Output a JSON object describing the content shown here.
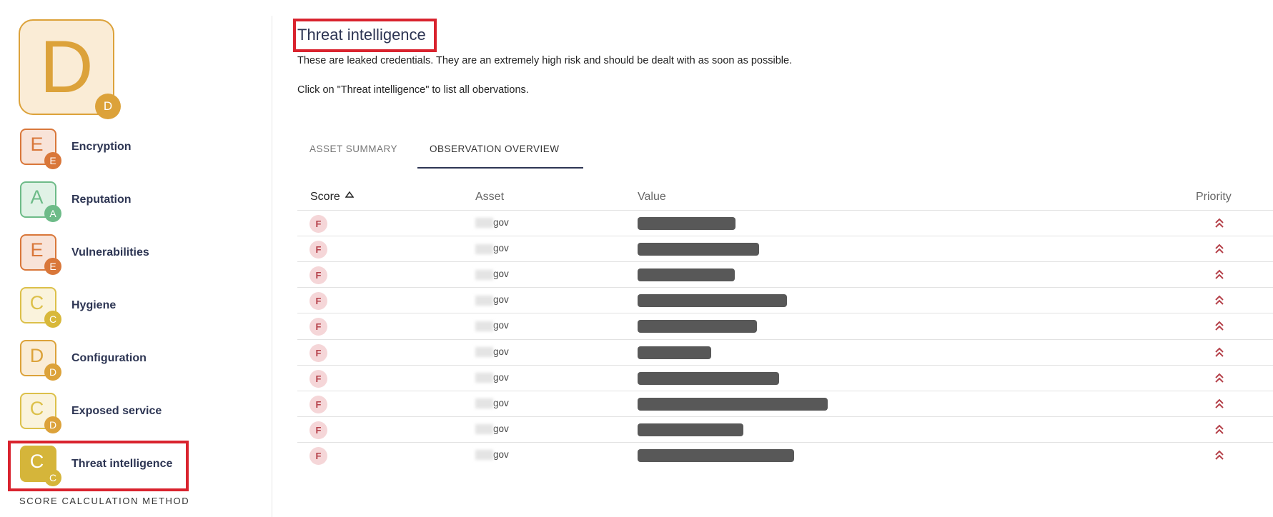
{
  "overall": {
    "grade": "D",
    "badge": "D",
    "color": "#dca23a"
  },
  "sidebar": {
    "items": [
      {
        "label": "Encryption",
        "grade": "E",
        "badge": "E",
        "color": "#d9773a",
        "bg": "#f8e3d8"
      },
      {
        "label": "Reputation",
        "grade": "A",
        "badge": "A",
        "color": "#6dbb88",
        "bg": "#e0f2e6"
      },
      {
        "label": "Vulnerabilities",
        "grade": "E",
        "badge": "E",
        "color": "#d9773a",
        "bg": "#f8e3d8"
      },
      {
        "label": "Hygiene",
        "grade": "C",
        "badge": "C",
        "color": "#dcc04a",
        "bg": "#faf3dc",
        "badge_color": "#d8b83a"
      },
      {
        "label": "Configuration",
        "grade": "D",
        "badge": "D",
        "color": "#dca23a",
        "bg": "#faecd6"
      },
      {
        "label": "Exposed service",
        "grade": "C",
        "badge": "D",
        "color": "#dcc04a",
        "bg": "#faf3dc",
        "badge_color": "#dca23a"
      },
      {
        "label": "Threat intelligence",
        "grade": "C",
        "badge": "C",
        "color": "#d5b53a",
        "bg": "#d5b53a",
        "selected": true
      }
    ],
    "footer": "SCORE CALCULATION METHOD"
  },
  "main": {
    "title": "Threat intelligence",
    "description": "These are leaked credentials. They are an extremely high risk and should be dealt with as soon as possible.",
    "hint": "Click on \"Threat intelligence\" to list all obervations.",
    "tabs": [
      {
        "label": "ASSET SUMMARY",
        "active": false
      },
      {
        "label": "OBSERVATION OVERVIEW",
        "active": true
      }
    ],
    "table": {
      "columns": [
        "Score",
        "Asset",
        "Value",
        "Priority"
      ],
      "sort_icon": "triangle-up-icon",
      "rows": [
        {
          "score": "F",
          "asset": "gov",
          "value_redacted": true,
          "priority": "high"
        },
        {
          "score": "F",
          "asset": "gov",
          "value_redacted": true,
          "priority": "high"
        },
        {
          "score": "F",
          "asset": "gov",
          "value_redacted": true,
          "priority": "high"
        },
        {
          "score": "F",
          "asset": "gov",
          "value_redacted": true,
          "priority": "high"
        },
        {
          "score": "F",
          "asset": "gov",
          "value_redacted": true,
          "priority": "high"
        },
        {
          "score": "F",
          "asset": "gov",
          "value_redacted": true,
          "priority": "high"
        },
        {
          "score": "F",
          "asset": "gov",
          "value_redacted": true,
          "priority": "high"
        },
        {
          "score": "F",
          "asset": "gov",
          "value_redacted": true,
          "priority": "high"
        },
        {
          "score": "F",
          "asset": "gov",
          "value_redacted": true,
          "priority": "high"
        },
        {
          "score": "F",
          "asset": "gov",
          "value_redacted": true,
          "priority": "high"
        }
      ]
    }
  },
  "colors": {
    "highlight": "#d9232e",
    "priority": "#b5414a",
    "text": "#2d3553"
  }
}
